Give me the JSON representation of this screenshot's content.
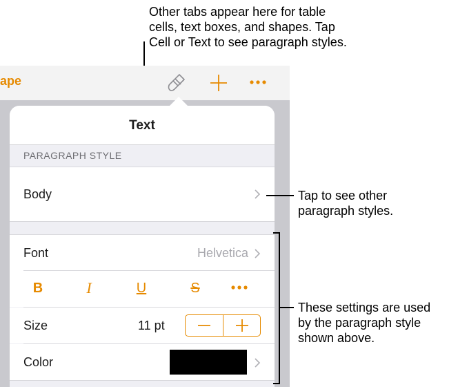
{
  "callouts": {
    "tabs": [
      "Other tabs appear here for table",
      "cells, text boxes, and shapes. Tap",
      "Cell or Text to see paragraph styles."
    ],
    "paragraph": [
      "Tap to see other",
      "paragraph styles."
    ],
    "settings": [
      "These settings are used",
      "by the paragraph style",
      "shown above."
    ]
  },
  "toolbar": {
    "shape_label": "ape",
    "icons": [
      "paintbrush-icon",
      "plus-icon",
      "more-icon"
    ]
  },
  "popover": {
    "title": "Text",
    "section_header": "PARAGRAPH STYLE",
    "paragraph_style": "Body",
    "font": {
      "label": "Font",
      "value": "Helvetica"
    },
    "style_buttons": {
      "bold": "B",
      "italic": "I",
      "underline": "U",
      "strike": "S"
    },
    "size": {
      "label": "Size",
      "value": "11 pt"
    },
    "color": {
      "label": "Color",
      "value": "#000000"
    }
  },
  "colors": {
    "accent": "#e68a00",
    "background": "#efeff4",
    "secondary_text": "#a8a8ae"
  }
}
